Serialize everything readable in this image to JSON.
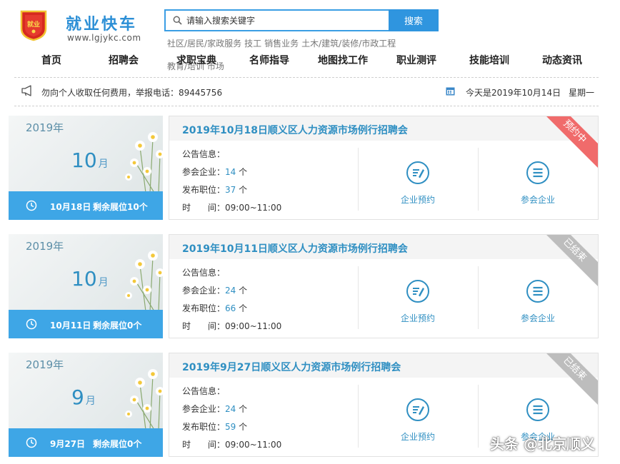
{
  "header": {
    "title": "就业快车",
    "url": "www.lgjykc.com",
    "logo_text": "就业"
  },
  "search": {
    "placeholder": "请输入搜索关键字",
    "button": "搜索"
  },
  "hot_tags": [
    "社区/居民/家政服务",
    "技工",
    "销售业务",
    "土木/建筑/装修/市政工程",
    "教育/培训 市场"
  ],
  "nav": [
    "首页",
    "招聘会",
    "求职宝典",
    "名师指导",
    "地图找工作",
    "职业测评",
    "技能培训",
    "动态资讯"
  ],
  "notice": {
    "text": "勿向个人收取任何费用，举报电话：89445756",
    "today": "今天是2019年10月14日",
    "weekday": "星期一"
  },
  "labels": {
    "info": "公告信息：",
    "companies": "参会企业：",
    "positions": "发布职位：",
    "time": "时　　间：",
    "unit": "个",
    "book": "企业预约",
    "attend": "参会企业",
    "month_suffix": "月"
  },
  "fairs": [
    {
      "year": "2019年",
      "month": "10",
      "date": "10月18日",
      "booths": "剩余展位10个",
      "title": "2019年10月18日顺义区人力资源市场例行招聘会",
      "status": "预约中",
      "companies": "14",
      "positions": "37",
      "time": "09:00~11:00"
    },
    {
      "year": "2019年",
      "month": "10",
      "date": "10月11日",
      "booths": "剩余展位0个",
      "title": "2019年10月11日顺义区人力资源市场例行招聘会",
      "status": "已结束",
      "companies": "24",
      "positions": "66",
      "time": "09:00~11:00"
    },
    {
      "year": "2019年",
      "month": "9",
      "date": "9月27日",
      "booths": "剩余展位0个",
      "title": "2019年9月27日顺义区人力资源市场例行招聘会",
      "status": "已结束",
      "companies": "24",
      "positions": "59",
      "time": "09:00~11:00"
    }
  ],
  "watermark": "头条 @北京顺义",
  "colors": {
    "brand": "#2f95df",
    "accent_text": "#2f8fc2",
    "ribbon_active": "#f06b6b",
    "ribbon_ended": "#bdbdbd",
    "date_footer": "#3ea6e6"
  }
}
